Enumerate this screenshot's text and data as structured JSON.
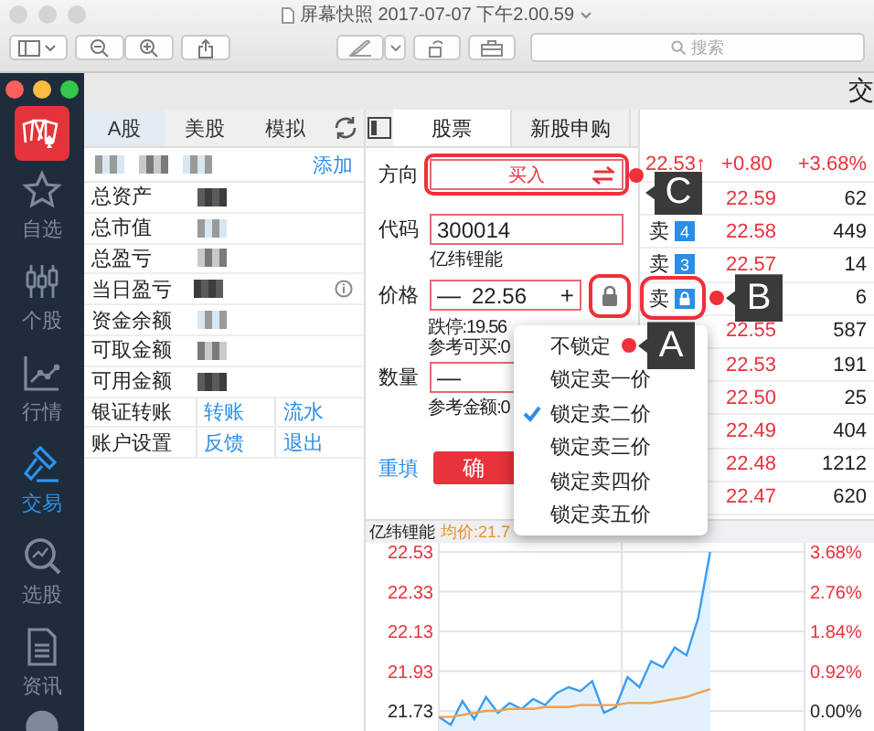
{
  "viewer": {
    "title": "屏幕快照 2017-07-07 下午2.00.59",
    "search": {
      "placeholder": "搜索"
    }
  },
  "app": {
    "header_title": "交"
  },
  "sidebar": {
    "items": [
      {
        "label": "自选",
        "selected": false
      },
      {
        "label": "个股",
        "selected": false
      },
      {
        "label": "行情",
        "selected": false
      },
      {
        "label": "交易",
        "selected": true
      },
      {
        "label": "选股",
        "selected": false
      },
      {
        "label": "资讯",
        "selected": false
      }
    ]
  },
  "account": {
    "tabs": [
      {
        "label": "A股",
        "selected": true
      },
      {
        "label": "美股",
        "selected": false
      },
      {
        "label": "模拟",
        "selected": false
      }
    ],
    "add_link": "添加",
    "rows": [
      {
        "label": "总资产",
        "redacted": true
      },
      {
        "label": "总市值",
        "redacted": true
      },
      {
        "label": "总盈亏",
        "redacted": true
      },
      {
        "label": "当日盈亏",
        "redacted": true,
        "info": true
      },
      {
        "label": "资金余额",
        "redacted": true
      },
      {
        "label": "可取金额",
        "redacted": true
      },
      {
        "label": "可用金额",
        "redacted": true
      }
    ],
    "link_rows": [
      {
        "label": "银证转账",
        "links": [
          "转账",
          "流水"
        ]
      },
      {
        "label": "账户设置",
        "links": [
          "反馈",
          "退出"
        ]
      }
    ]
  },
  "order_form": {
    "tabs": [
      {
        "label": "股票",
        "selected": true
      },
      {
        "label": "新股申购",
        "selected": false
      }
    ],
    "direction": {
      "label": "方向",
      "value": "买入",
      "callout": "C"
    },
    "code": {
      "label": "代码",
      "value": "300014",
      "name": "亿纬锂能"
    },
    "price": {
      "label": "价格",
      "minus": "—",
      "value": "22.56",
      "plus": "+",
      "locked": true,
      "highlighted": true
    },
    "limit_down": "跌停:19.56",
    "buyable": "参考可买:0",
    "quantity": {
      "label": "数量",
      "minus": "—"
    },
    "amount": "参考金额:0",
    "reset": "重填",
    "confirm": "确"
  },
  "order_book": {
    "quote": {
      "price": "22.53↑",
      "change": "+0.80",
      "percent": "+3.68%"
    },
    "rows": [
      {
        "price": "22.59",
        "volume": "62"
      },
      {
        "side": "卖",
        "badge": {
          "kind": "number",
          "text": "4"
        },
        "price": "22.58",
        "volume": "449"
      },
      {
        "side": "卖",
        "badge": {
          "kind": "number",
          "text": "3"
        },
        "price": "22.57",
        "volume": "14"
      },
      {
        "side": "卖",
        "badge": {
          "kind": "lock"
        },
        "volume": "6",
        "callout": "B"
      },
      {
        "price": "22.55",
        "volume": "587"
      },
      {
        "price": "22.53",
        "volume": "191"
      },
      {
        "price": "22.50",
        "volume": "25"
      },
      {
        "price": "22.49",
        "volume": "404"
      },
      {
        "price": "22.48",
        "volume": "1212"
      },
      {
        "price": "22.47",
        "volume": "620"
      }
    ]
  },
  "lock_menu": {
    "items": [
      {
        "label": "不锁定",
        "checked": false,
        "callout": "A"
      },
      {
        "label": "锁定卖一价",
        "checked": false
      },
      {
        "label": "锁定卖二价",
        "checked": true
      },
      {
        "label": "锁定卖三价",
        "checked": false
      },
      {
        "label": "锁定卖四价",
        "checked": false
      },
      {
        "label": "锁定卖五价",
        "checked": false
      }
    ]
  },
  "chart": {
    "stock_name": "亿纬锂能",
    "average": "均价:21.7",
    "percent_ticks": [
      {
        "text": "3.68%",
        "kind": "up"
      },
      {
        "text": "2.76%",
        "kind": "up"
      },
      {
        "text": "1.84%",
        "kind": "up"
      },
      {
        "text": "0.92%",
        "kind": "up"
      },
      {
        "text": "0.00%",
        "kind": "flat"
      }
    ],
    "chart_data": {
      "type": "area",
      "grid": true,
      "categories": [
        null,
        null,
        null,
        null,
        null,
        null,
        null,
        null,
        null,
        null,
        null,
        null,
        null,
        null,
        null,
        null,
        null,
        null,
        null,
        null,
        null,
        null,
        null,
        null,
        null,
        null,
        null,
        null,
        null,
        null,
        null,
        null
      ],
      "ylim": [
        21.62,
        22.53
      ],
      "yticks": [
        {
          "value": 22.53,
          "label": "22.53"
        },
        {
          "value": 22.33,
          "label": "22.33"
        },
        {
          "value": 22.13,
          "label": "22.13"
        },
        {
          "value": 21.93,
          "label": "21.93"
        },
        {
          "value": 21.73,
          "label": "21.73"
        }
      ],
      "series": [
        {
          "color": "#3a9df0",
          "values": [
            21.7,
            21.66,
            21.78,
            21.69,
            21.8,
            21.72,
            21.77,
            21.74,
            21.79,
            21.76,
            21.82,
            21.85,
            21.83,
            21.88,
            21.72,
            21.75,
            21.9,
            21.85,
            21.98,
            21.95,
            22.05,
            22.01,
            22.2,
            22.53,
            null,
            null,
            null,
            null,
            null,
            null,
            null,
            null
          ]
        },
        {
          "type": "line",
          "color": "#f0a050",
          "values": [
            21.7,
            21.7,
            21.71,
            21.72,
            21.73,
            21.73,
            21.74,
            21.74,
            21.74,
            21.75,
            21.75,
            21.75,
            21.76,
            21.76,
            21.76,
            21.76,
            21.77,
            21.77,
            21.77,
            21.78,
            21.79,
            21.8,
            21.82,
            21.84,
            null,
            null,
            null,
            null,
            null,
            null,
            null,
            null
          ]
        }
      ]
    }
  }
}
